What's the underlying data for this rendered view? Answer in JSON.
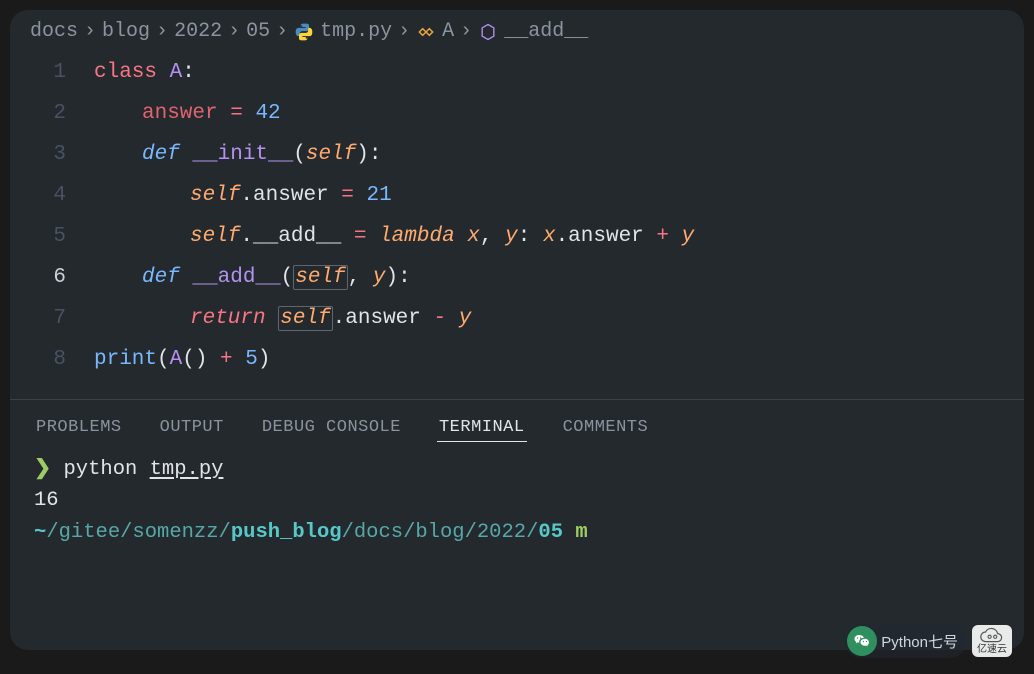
{
  "breadcrumb": {
    "items": [
      "docs",
      "blog",
      "2022",
      "05",
      "tmp.py",
      "A",
      "__add__"
    ],
    "sep": "›"
  },
  "code": {
    "lines": [
      "1",
      "2",
      "3",
      "4",
      "5",
      "6",
      "7",
      "8"
    ],
    "active_line": "6",
    "kw_class": "class",
    "cls_name": "A",
    "colon": ":",
    "ident_answer": "answer",
    "eq": " = ",
    "num_42": "42",
    "num_21": "21",
    "num_5": "5",
    "kw_def": "def",
    "func_init": "__init__",
    "func_add": "__add__",
    "lp": "(",
    "rp": ")",
    "comma": ", ",
    "self": "self",
    "dot": ".",
    "kw_lambda": "lambda",
    "param_x": "x",
    "param_y": "y",
    "plus": " + ",
    "minus": " - ",
    "kw_return": "return",
    "sp": " ",
    "sp2": "  ",
    "print": "print",
    "call_open": "(",
    "call_close": "()",
    "A_call": "A"
  },
  "panel": {
    "tabs": [
      "PROBLEMS",
      "OUTPUT",
      "DEBUG CONSOLE",
      "TERMINAL",
      "COMMENTS"
    ],
    "active": "TERMINAL"
  },
  "terminal": {
    "prompt": "❯",
    "cmd": "python",
    "file": "tmp.py",
    "output": "16",
    "cwd_tilde": "~",
    "cwd_parts": [
      "/gitee/somenzz/",
      "push_blog",
      "/docs/blog/2022/",
      "05"
    ],
    "tail": " m"
  },
  "watermark": {
    "left_text": "Python七号",
    "right_text": "亿速云"
  }
}
